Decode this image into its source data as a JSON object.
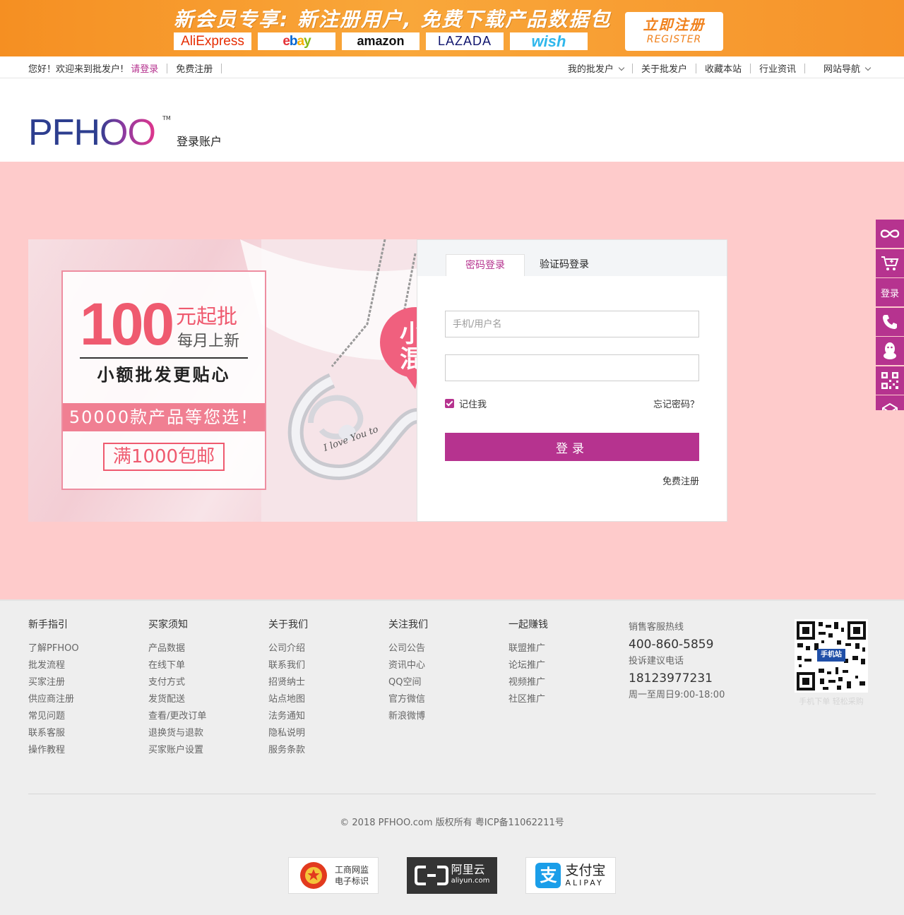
{
  "banner": {
    "title": "新会员专享: 新注册用户, 免费下载产品数据包",
    "logos": [
      "AliExpress",
      "ebay",
      "amazon",
      "LAZADA",
      "wish"
    ],
    "register_cn": "立即注册",
    "register_en": "REGISTER",
    "colors": {
      "orange": "#f58f22"
    }
  },
  "topnav": {
    "greeting": "您好！欢迎来到批发户!",
    "login": "请登录",
    "register": "免费注册",
    "right_items": [
      "我的批发户",
      "关于批发户",
      "收藏本站",
      "行业资讯",
      "网站导航"
    ]
  },
  "header": {
    "brand": "PFHOO",
    "tm": "TM",
    "title": "登录账户"
  },
  "promo": {
    "big_number": "100",
    "yuan": "元起批",
    "monthly": "每月上新",
    "slogan": "小额批发更贴心",
    "band": "50000款产品等您选！",
    "shipping": "满1000包邮",
    "bubble": "小\n混",
    "engraving": "I love You to"
  },
  "login": {
    "tab_password": "密码登录",
    "tab_code": "验证码登录",
    "username_placeholder": "手机/用户名",
    "password_value": "",
    "remember": "记住我",
    "forgot": "忘记密码？",
    "submit": "登录",
    "free_register": "免费注册",
    "colors": {
      "accent": "#b6338f",
      "background": "#fecbcb"
    }
  },
  "floatbar": {
    "items": [
      "infinity-icon",
      "cart-icon",
      "登录",
      "phone-icon",
      "qq-icon",
      "qr-icon",
      "mail-icon"
    ]
  },
  "footer": {
    "columns": [
      {
        "title": "新手指引",
        "items": [
          "了解PFHOO",
          "批发流程",
          "买家注册",
          "供应商注册",
          "常见问题",
          "联系客服",
          "操作教程"
        ]
      },
      {
        "title": "买家须知",
        "items": [
          "产品数据",
          "在线下单",
          "支付方式",
          "发货配送",
          "查看/更改订单",
          "退换货与退款",
          "买家账户设置"
        ]
      },
      {
        "title": "关于我们",
        "items": [
          "公司介绍",
          "联系我们",
          "招贤纳士",
          "站点地图",
          "法务通知",
          "隐私说明",
          "服务条款"
        ]
      },
      {
        "title": "关注我们",
        "items": [
          "公司公告",
          "资讯中心",
          "QQ空间",
          "官方微信",
          "新浪微博"
        ]
      },
      {
        "title": "一起赚钱",
        "items": [
          "联盟推广",
          "论坛推广",
          "视频推广",
          "社区推广"
        ]
      }
    ],
    "contact": {
      "sales_label": "销售客服热线",
      "sales_tel": "400-860-5859",
      "complaint_label": "投诉建议电话",
      "complaint_tel": "18123977231",
      "hours": "周一至周日9:00-18:00"
    },
    "qr_badge": "手机站",
    "qr_caption": "手机下单 轻松采购",
    "copyright": "© 2018 PFHOO.com 版权所有 粤ICP备11062211号",
    "badges": {
      "gongshang_1": "工商网监",
      "gongshang_2": "电子标识",
      "aliyun_cn": "阿里云",
      "aliyun_en": "aliyun.com",
      "alipay_cn": "支付宝",
      "alipay_en": "ALIPAY"
    }
  }
}
